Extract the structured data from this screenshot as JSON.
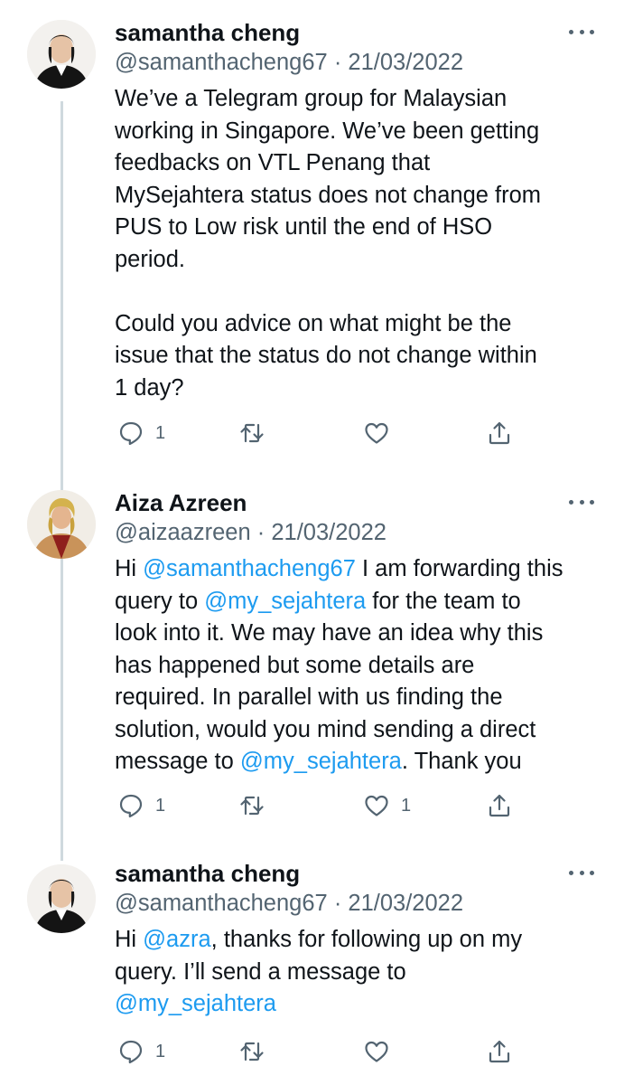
{
  "tweets": [
    {
      "author_name": "samantha cheng",
      "handle": "@samanthacheng67",
      "separator": "·",
      "date": "21/03/2022",
      "avatar": "person-photo-icon",
      "paragraphs": [
        [
          "We’ve a Telegram group for Malaysian",
          "working in Singapore. We’ve been getting",
          "feedbacks on VTL Penang that",
          "MySejahtera status does not change from",
          "PUS to Low risk until the end of HSO",
          "period."
        ],
        [
          "Could you advice on what might be the",
          "issue that the status do not change within",
          "1 day?"
        ]
      ],
      "replies": "1",
      "retweets": "",
      "likes": ""
    },
    {
      "author_name": "Aiza Azreen",
      "handle": "@aizaazreen",
      "separator": "·",
      "date": "21/03/2022",
      "avatar": "person-photo-icon",
      "segments": {
        "l1_a": "Hi ",
        "l1_m": "@samanthacheng67",
        "l1_b": " I am forwarding this",
        "l2_a": "query to ",
        "l2_m": "@my_sejahtera",
        "l2_b": " for the team to",
        "l3": "look into it. We may have an idea why this",
        "l4": "has happened but some details are",
        "l5": "required. In parallel with us finding the",
        "l6": "solution, would you mind sending a direct",
        "l7_a": "message to ",
        "l7_m": "@my_sejahtera",
        "l7_b": ". Thank you"
      },
      "replies": "1",
      "retweets": "",
      "likes": "1"
    },
    {
      "author_name": "samantha cheng",
      "handle": "@samanthacheng67",
      "separator": "·",
      "date": "21/03/2022",
      "avatar": "person-photo-icon",
      "segments": {
        "l1_a": "Hi ",
        "l1_m": "@azra",
        "l1_b": ", thanks for following up on my",
        "l2": "query. I’ll send a message to",
        "l3_m": "@my_sejahtera"
      },
      "replies": "1",
      "retweets": "",
      "likes": ""
    }
  ],
  "colors": {
    "text": "#0f1419",
    "secondary": "#536471",
    "mention": "#1d9bf0",
    "thread_line": "#cfd9de"
  }
}
